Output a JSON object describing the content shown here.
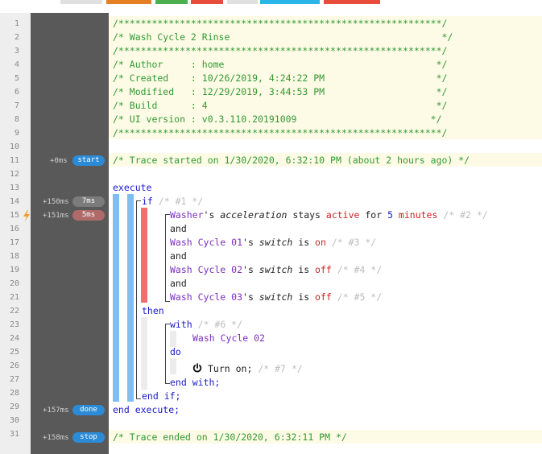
{
  "toolbar": {
    "buttons": [
      {
        "color": "#e0e0e0"
      },
      {
        "color": "#e67e22"
      },
      {
        "color": "#4caf50"
      },
      {
        "color": "#e74c3c"
      },
      {
        "color": "#e0e0e0"
      },
      {
        "color": "#2bb5e8"
      },
      {
        "color": "#e74c3c"
      }
    ]
  },
  "line_numbers": [
    "1",
    "2",
    "3",
    "4",
    "5",
    "6",
    "7",
    "8",
    "9",
    "10",
    "11",
    "12",
    "13",
    "14",
    "15",
    "16",
    "17",
    "18",
    "19",
    "20",
    "21",
    "22",
    "23",
    "24",
    "25",
    "26",
    "27",
    "28",
    "29",
    "30",
    "31"
  ],
  "header": {
    "border": "/**********************************************************/",
    "title": "/* Wash Cycle 2 Rinse                                      */",
    "author": "/* Author     : home                                      */",
    "created": "/* Created    : 10/26/2019, 4:24:22 PM                    */",
    "modified": "/* Modified   : 12/29/2019, 3:44:53 PM                    */",
    "build": "/* Build      : 4                                         */",
    "ui_version": "/* UI version : v0.3.110.20191009                        */"
  },
  "trace": {
    "start_time": "+0ms",
    "start_label": "start",
    "start_text": "/* Trace started on 1/30/2020, 6:32:10 PM (about 2 hours ago) */",
    "if_time": "+150ms",
    "if_label": "7ms",
    "cond_time": "+151ms",
    "cond_label": "5ms",
    "done_time": "+157ms",
    "done_label": "done",
    "stop_time": "+158ms",
    "stop_label": "stop",
    "end_text": "/* Trace ended on 1/30/2020, 6:32:11 PM */"
  },
  "code": {
    "execute": "execute",
    "if": "if",
    "if_comment": "/* #1 */",
    "cond1_device": "Washer",
    "cond1_poss": "'s ",
    "cond1_attr": "acceleration",
    "cond1_stays": " stays ",
    "cond1_value": "active",
    "cond1_for": " for ",
    "cond1_num": "5",
    "cond1_unit": " minutes",
    "cond1_comment": "/* #2 */",
    "and1": "and",
    "cond2_device": "Wash Cycle 01",
    "cond2_poss": "'s ",
    "cond2_attr": "switch",
    "cond2_is": " is ",
    "cond2_value": "on",
    "cond2_comment": "/* #3 */",
    "and2": "and",
    "cond3_device": "Wash Cycle 02",
    "cond3_poss": "'s ",
    "cond3_attr": "switch",
    "cond3_is": " is ",
    "cond3_value": "off",
    "cond3_comment": "/* #4 */",
    "and3": "and",
    "cond4_device": "Wash Cycle 03",
    "cond4_poss": "'s ",
    "cond4_attr": "switch",
    "cond4_is": " is ",
    "cond4_value": "off",
    "cond4_comment": "/* #5 */",
    "then": "then",
    "with": "with",
    "with_comment": "/* #6 */",
    "with_device": "Wash Cycle 02",
    "do": "do",
    "action": "Turn on;",
    "action_comment": "/* #7 */",
    "end_with": "end with;",
    "end_if": "end if;",
    "end_execute": "end execute;"
  },
  "colors": {
    "accent_blue": "#2b8bd6",
    "bar_blue": "#80bdf2",
    "bar_red": "#f07070",
    "bar_light": "#ececec"
  }
}
